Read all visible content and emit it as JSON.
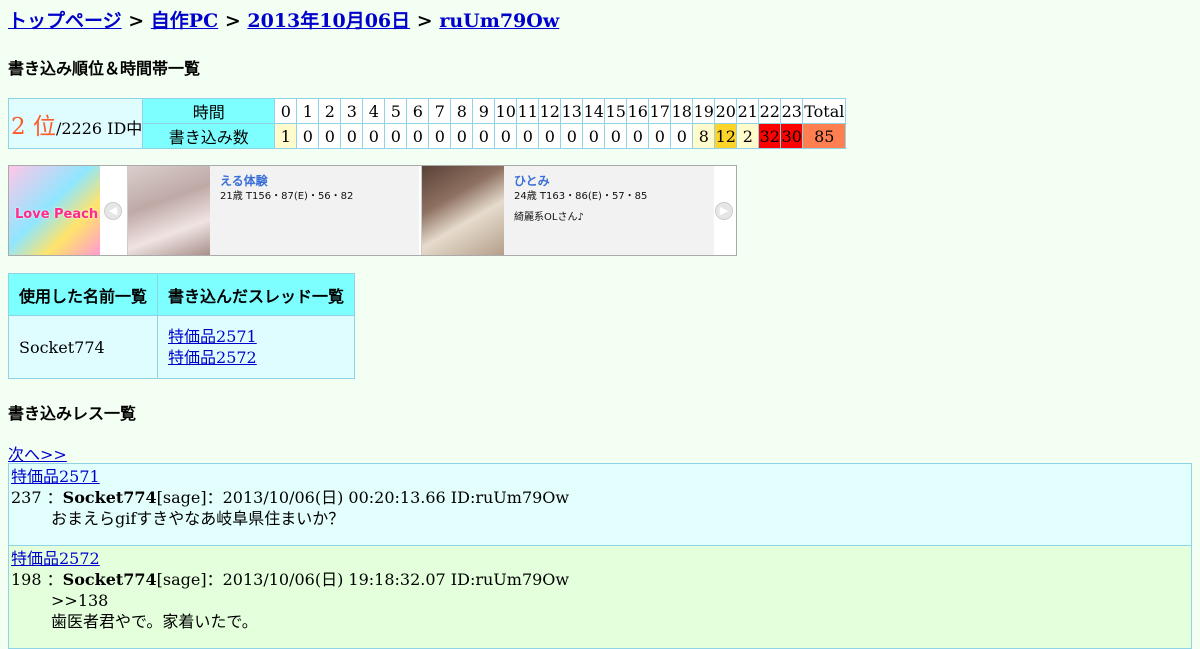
{
  "breadcrumb": {
    "items": [
      "トップページ",
      "自作PC",
      "2013年10月06日",
      "ruUm79Ow"
    ],
    "separator": ">"
  },
  "rank_heading": "書き込み順位＆時間帯一覧",
  "rank": {
    "position": "2 位",
    "total": "/2226 ID中",
    "hour_label": "時間",
    "count_label": "書き込み数",
    "hours": [
      "0",
      "1",
      "2",
      "3",
      "4",
      "5",
      "6",
      "7",
      "8",
      "9",
      "10",
      "11",
      "12",
      "13",
      "14",
      "15",
      "16",
      "17",
      "18",
      "19",
      "20",
      "21",
      "22",
      "23",
      "Total"
    ],
    "counts": [
      "1",
      "0",
      "0",
      "0",
      "0",
      "0",
      "0",
      "0",
      "0",
      "0",
      "0",
      "0",
      "0",
      "0",
      "0",
      "0",
      "0",
      "0",
      "0",
      "8",
      "12",
      "2",
      "32",
      "30",
      "85"
    ]
  },
  "ads": {
    "banner_text": "Love Peach",
    "cards": [
      {
        "name": "える体験",
        "spec": "21歳 T156・87(E)・56・82",
        "desc": ""
      },
      {
        "name": "ひとみ",
        "spec": "24歳 T163・86(E)・57・85",
        "desc": "綺麗系OLさん♪"
      }
    ]
  },
  "names_table": {
    "col_names": "使用した名前一覧",
    "col_threads": "書き込んだスレッド一覧",
    "name": "Socket774",
    "threads": [
      "特価品2571",
      "特価品2572"
    ]
  },
  "res_heading": "書き込みレス一覧",
  "next_link": "次へ>>",
  "posts": [
    {
      "thread": "特価品2571",
      "num": "237",
      "name": "Socket774",
      "meta": "[sage]：2013/10/06(日) 00:20:13.66 ID:ruUm79Ow",
      "lines": [
        "おまえらgifすきやなあ岐阜県住まいか？"
      ]
    },
    {
      "thread": "特価品2572",
      "num": "198",
      "name": "Socket774",
      "meta": "[sage]：2013/10/06(日) 19:18:32.07 ID:ruUm79Ow",
      "lines": [
        ">>138",
        "歯医者君やで。家着いたで。"
      ]
    }
  ]
}
